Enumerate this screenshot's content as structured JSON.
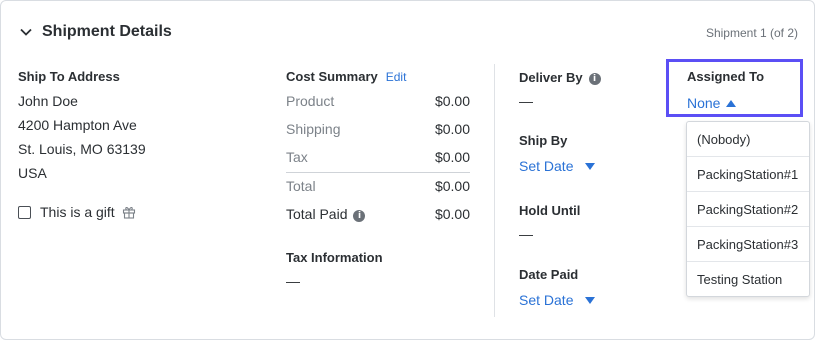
{
  "header": {
    "title": "Shipment Details",
    "shipment_count": "Shipment 1 (of 2)"
  },
  "ship_to": {
    "label": "Ship To Address",
    "lines": [
      "John Doe",
      "4200 Hampton Ave",
      "St. Louis, MO 63139",
      "USA"
    ],
    "gift_label": "This is a gift",
    "gift_checked": false
  },
  "cost_summary": {
    "label": "Cost Summary",
    "edit_label": "Edit",
    "rows": [
      {
        "label": "Product",
        "value": "$0.00"
      },
      {
        "label": "Shipping",
        "value": "$0.00"
      },
      {
        "label": "Tax",
        "value": "$0.00"
      },
      {
        "label": "Total",
        "value": "$0.00"
      },
      {
        "label": "Total Paid",
        "value": "$0.00"
      }
    ],
    "tax_info_label": "Tax Information",
    "tax_info_value": "—"
  },
  "dates": {
    "deliver_by": {
      "label": "Deliver By",
      "value": "—"
    },
    "ship_by": {
      "label": "Ship By",
      "value": "Set Date"
    },
    "hold_until": {
      "label": "Hold Until",
      "value": "—"
    },
    "date_paid": {
      "label": "Date Paid",
      "value": "Set Date"
    }
  },
  "assigned_to": {
    "label": "Assigned To",
    "value": "None",
    "options": [
      "(Nobody)",
      "PackingStation#1",
      "PackingStation#2",
      "PackingStation#3",
      "Testing Station"
    ]
  },
  "colors": {
    "link": "#2a72d6",
    "highlight": "#5b4ff5"
  }
}
